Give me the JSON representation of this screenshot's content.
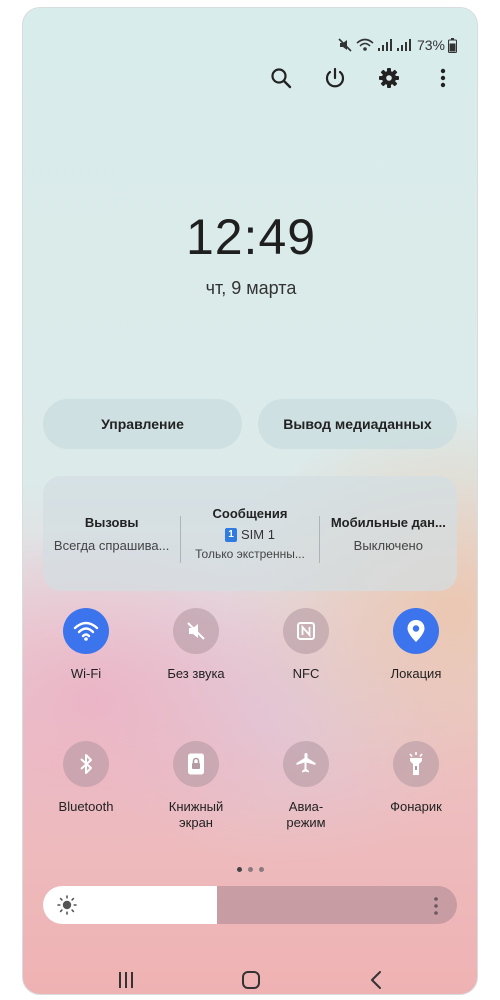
{
  "status": {
    "battery": "73%"
  },
  "clock": {
    "time": "12:49",
    "date": "чт, 9 марта"
  },
  "buttons": {
    "control": "Управление",
    "media_output": "Вывод медиаданных"
  },
  "sim": {
    "calls_title": "Вызовы",
    "calls_value": "Всегда спрашива...",
    "messages_title": "Сообщения",
    "messages_sim_badge": "1",
    "messages_sim": "SIM 1",
    "messages_note": "Только экстренны...",
    "data_title": "Мобильные дан...",
    "data_value": "Выключено"
  },
  "tiles": [
    {
      "label": "Wi-Fi",
      "icon": "wifi-icon",
      "active": true
    },
    {
      "label": "Без звука",
      "icon": "mute-icon",
      "active": false
    },
    {
      "label": "NFC",
      "icon": "nfc-icon",
      "active": false
    },
    {
      "label": "Локация",
      "icon": "location-icon",
      "active": true
    },
    {
      "label": "Bluetooth",
      "icon": "bluetooth-icon",
      "active": false
    },
    {
      "label": "Книжный\nэкран",
      "icon": "portrait-lock-icon",
      "active": false
    },
    {
      "label": "Авиа-\nрежим",
      "icon": "airplane-icon",
      "active": false
    },
    {
      "label": "Фонарик",
      "icon": "flashlight-icon",
      "active": false
    }
  ],
  "pager": {
    "pages": 3,
    "current": 1
  },
  "brightness": {
    "level": 0.42
  },
  "colors": {
    "accent": "#3b74ec",
    "tile_off": "#b098a0"
  }
}
